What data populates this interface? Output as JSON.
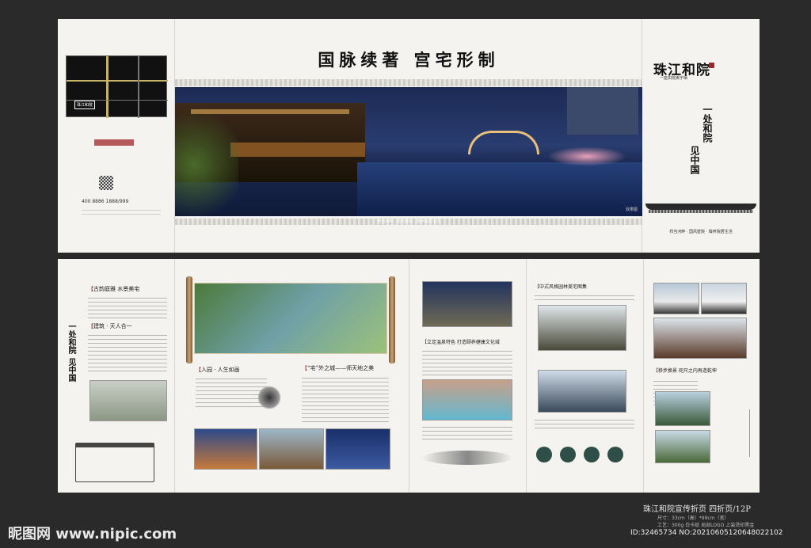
{
  "cover": {
    "headline": "国脉续著 宫宅形制",
    "brand_title": "珠江和院",
    "brand_sub": "一座如院美宇栖",
    "vertical_slogan_1": "一处和院",
    "vertical_slogan_2": "见中国",
    "tagline": "栉当河畔 · 国风墅院 · 臻养院居生活",
    "phone": "400 8886 1888/999",
    "map_label": "珠江和院",
    "render_tag": "效果图"
  },
  "inside": {
    "h1": "古韵庭雅 水景美宅",
    "h2": "建筑 · 天人合一",
    "h3": "入园 · 人生如画",
    "h4": "“宅”外之城——师天地之美",
    "h5": "立足温泉特色 打造颐养健康文化城",
    "h6": "中式风格园林美宅图集",
    "h7": "移步换景 咫尺之内再造乾坤",
    "vertical_slogan_1": "一处和院",
    "vertical_slogan_2": "见中国"
  },
  "footer": {
    "watermark": "昵图网 www.nipic.com",
    "caption_title": "珠江和院宣传折页 四折页/12P",
    "caption_size": "尺寸：33cm（高）*99cm（宽）",
    "caption_craft": "工艺：300g 白卡纸 局部LOGO 上装烫印黑金",
    "caption_id": "ID:32465734 NO:20210605120648022102"
  },
  "colors": {
    "accent": "#a0262a",
    "night_sky": "#1c2a55",
    "ink": "#1a1a1a"
  }
}
